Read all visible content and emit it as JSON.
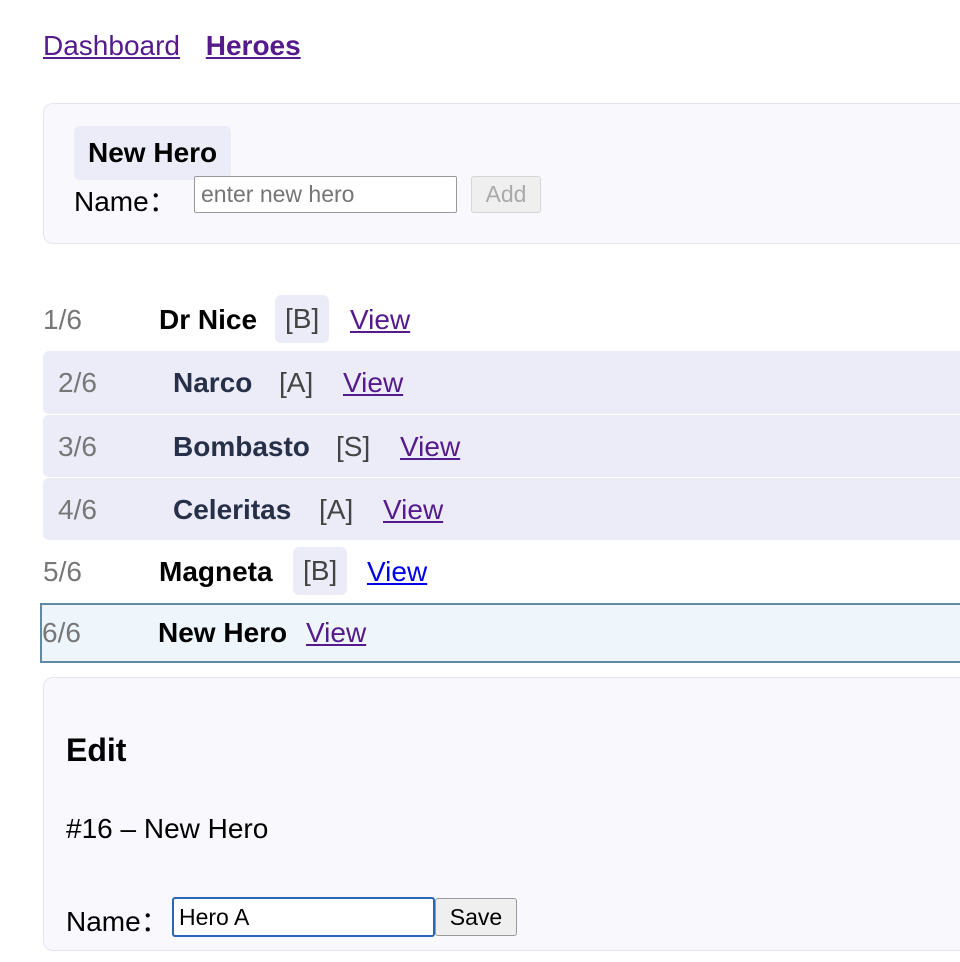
{
  "nav": {
    "dashboard": "Dashboard",
    "heroes": "Heroes"
  },
  "add_form": {
    "title": "New Hero",
    "name_label": "Name：",
    "input_placeholder": "enter new hero",
    "add_button": "Add"
  },
  "heroes": [
    {
      "index": "1/6",
      "name": "Dr Nice",
      "rank": "[B]",
      "link": "View"
    },
    {
      "index": "2/6",
      "name": "Narco",
      "rank": "[A]",
      "link": "View"
    },
    {
      "index": "3/6",
      "name": "Bombasto",
      "rank": "[S]",
      "link": "View"
    },
    {
      "index": "4/6",
      "name": "Celeritas",
      "rank": "[A]",
      "link": "View"
    },
    {
      "index": "5/6",
      "name": "Magneta",
      "rank": "[B]",
      "link": "View"
    },
    {
      "index": "6/6",
      "name": "New Hero",
      "rank": "",
      "link": "View"
    }
  ],
  "edit": {
    "title": "Edit",
    "subtitle": "#16 – New Hero",
    "name_label": "Name：",
    "input_value": "Hero A",
    "save_button": "Save"
  },
  "colors": {
    "link": "#551a8b",
    "unvisited_link": "#0000ee",
    "selected_bg": "#ececf8",
    "current_border": "#5f8aa1"
  }
}
